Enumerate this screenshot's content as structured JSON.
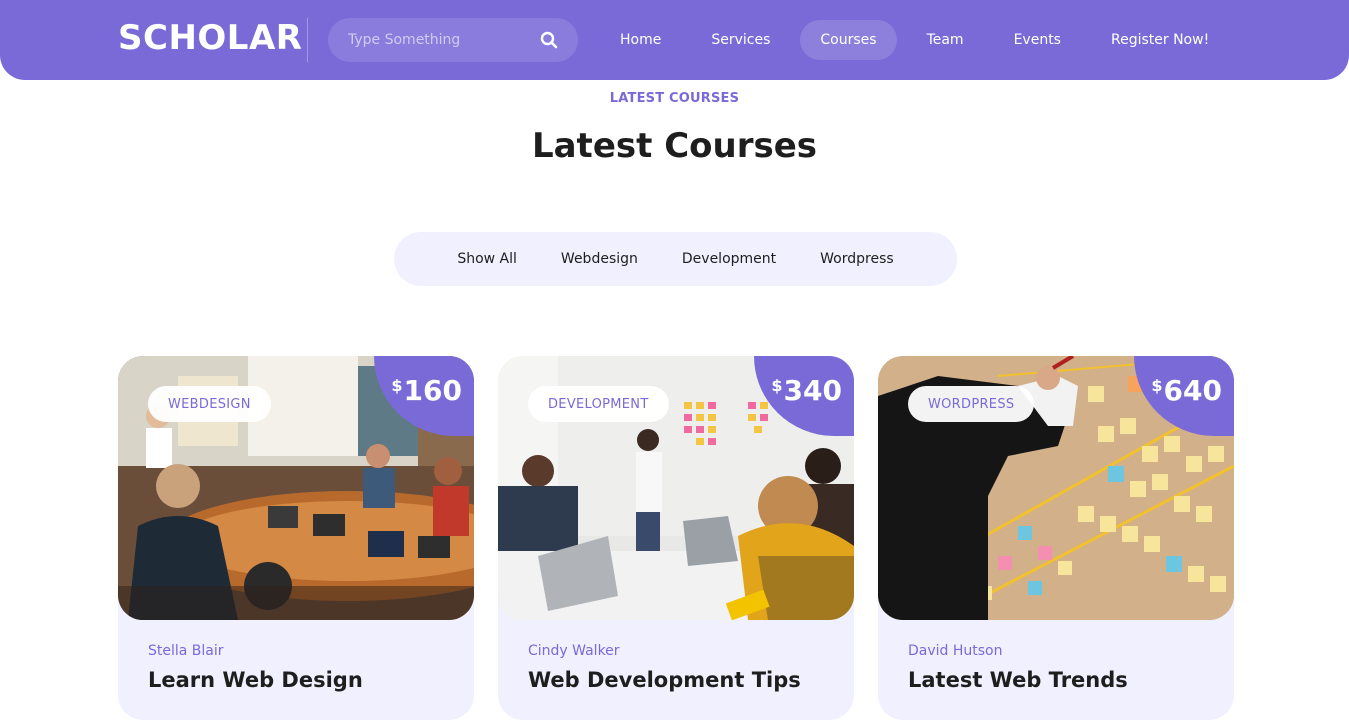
{
  "header": {
    "logo": "SCHOLAR",
    "search": {
      "placeholder": "Type Something",
      "icon": "search-icon"
    },
    "nav": [
      {
        "label": "Home",
        "active": false
      },
      {
        "label": "Services",
        "active": false
      },
      {
        "label": "Courses",
        "active": true
      },
      {
        "label": "Team",
        "active": false
      },
      {
        "label": "Events",
        "active": false
      },
      {
        "label": "Register Now!",
        "active": false
      }
    ]
  },
  "section": {
    "eyebrow": "LATEST COURSES",
    "title": "Latest Courses"
  },
  "filters": [
    {
      "label": "Show All"
    },
    {
      "label": "Webdesign"
    },
    {
      "label": "Development"
    },
    {
      "label": "Wordpress"
    }
  ],
  "courses": [
    {
      "tag": "WEBDESIGN",
      "currency": "$",
      "price": "160",
      "author": "Stella Blair",
      "title": "Learn Web Design"
    },
    {
      "tag": "DEVELOPMENT",
      "currency": "$",
      "price": "340",
      "author": "Cindy Walker",
      "title": "Web Development Tips"
    },
    {
      "tag": "WORDPRESS",
      "currency": "$",
      "price": "640",
      "author": "David Hutson",
      "title": "Latest Web Trends"
    }
  ],
  "colors": {
    "accent": "#7a6ad8",
    "light_bg": "#f1f0fe",
    "text": "#1e1e1e"
  }
}
